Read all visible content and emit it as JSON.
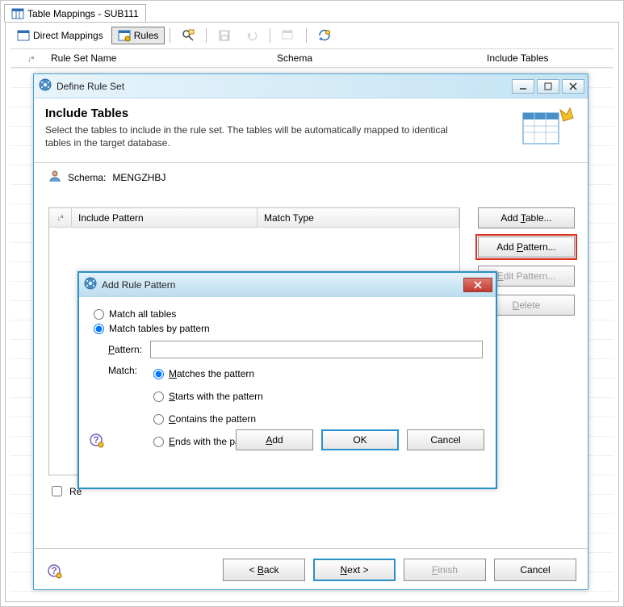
{
  "editor": {
    "tab_title": "Table Mappings - SUB111"
  },
  "toolbar": {
    "direct_mappings": "Direct Mappings",
    "rules": "Rules"
  },
  "columns": {
    "rule_set_name": "Rule Set Name",
    "schema": "Schema",
    "include_tables": "Include Tables"
  },
  "dialog_rule": {
    "title": "Define Rule Set",
    "heading": "Include Tables",
    "description": "Select the tables to include in the rule set. The tables will be automatically mapped to identical tables in the target database.",
    "schema_label": "Schema:",
    "schema_value": "MENGZHBJ",
    "col_include_pattern": "Include Pattern",
    "col_match_type": "Match Type",
    "btn_add_table": "Add Table...",
    "btn_add_pattern": "Add Pattern...",
    "btn_edit_pattern": "Edit Pattern...",
    "btn_delete": "Delete",
    "reorder_label": "Re",
    "back": "< Back",
    "next": "Next >",
    "finish": "Finish",
    "cancel": "Cancel"
  },
  "dialog_pattern": {
    "title": "Add Rule Pattern",
    "match_all": "Match all tables",
    "match_by": "Match tables by pattern",
    "pattern_label": "Pattern:",
    "pattern_value": "",
    "match_label": "Match:",
    "opt_matches": "Matches the pattern",
    "opt_starts": "Starts with the pattern",
    "opt_contains": "Contains the pattern",
    "opt_ends": "Ends with the pattern",
    "add": "Add",
    "ok": "OK",
    "cancel": "Cancel"
  },
  "accel": {
    "table_u": "T",
    "pattern_u": "P",
    "edit_u": "E",
    "delete_u": "D",
    "back_u": "B",
    "next_u": "N",
    "finish_u": "F",
    "patlabel_u": "P",
    "matches_u": "M",
    "starts_u": "S",
    "contains_u": "C",
    "ends_u": "E",
    "add_u": "A"
  }
}
